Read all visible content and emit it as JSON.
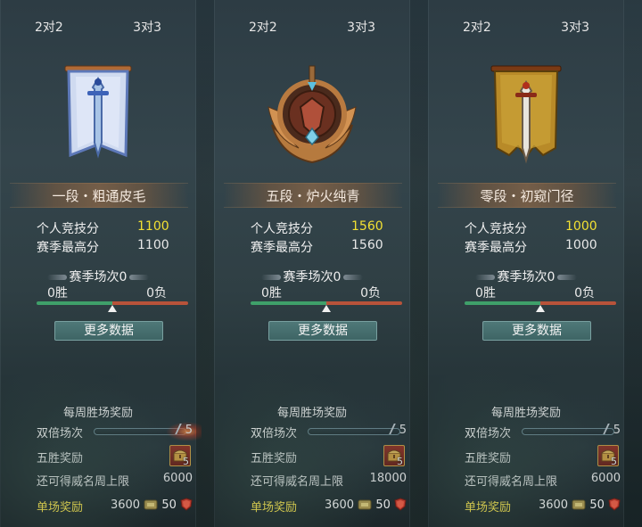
{
  "panels": [
    {
      "tabs": {
        "left": "2对2",
        "right": "3对3"
      },
      "rank_name": "一段・粗通皮毛",
      "emblem": "blue-banner-sword-icon",
      "stats": {
        "personal_label": "个人竞技分",
        "personal_value": "1100",
        "season_best_label": "赛季最高分",
        "season_best_value": "1100"
      },
      "season": {
        "title": "赛季场次0",
        "wins": "0胜",
        "losses": "0负",
        "win_ratio": 0.5
      },
      "more_button": "更多数据",
      "weekly": {
        "title": "每周胜场奖励",
        "double_label": "双倍场次",
        "double_count": "5",
        "double_progress": 0.0,
        "five_win_label": "五胜奖励",
        "chest_count": "5",
        "prestige_label": "还可得威名周上限",
        "prestige_value": "6000",
        "single_label": "单场奖励",
        "single_coins": "3600",
        "single_shield": "50"
      }
    },
    {
      "tabs": {
        "left": "2对2",
        "right": "3对3"
      },
      "rank_name": "五段・炉火纯青",
      "emblem": "bronze-winged-crest-icon",
      "stats": {
        "personal_label": "个人竞技分",
        "personal_value": "1560",
        "season_best_label": "赛季最高分",
        "season_best_value": "1560"
      },
      "season": {
        "title": "赛季场次0",
        "wins": "0胜",
        "losses": "0负",
        "win_ratio": 0.5
      },
      "more_button": "更多数据",
      "weekly": {
        "title": "每周胜场奖励",
        "double_label": "双倍场次",
        "double_count": "5",
        "double_progress": 0.0,
        "five_win_label": "五胜奖励",
        "chest_count": "5",
        "prestige_label": "还可得威名周上限",
        "prestige_value": "18000",
        "single_label": "单场奖励",
        "single_coins": "3600",
        "single_shield": "50"
      }
    },
    {
      "tabs": {
        "left": "2对2",
        "right": "3对3"
      },
      "rank_name": "零段・初窥门径",
      "emblem": "gold-banner-sword-icon",
      "stats": {
        "personal_label": "个人竞技分",
        "personal_value": "1000",
        "season_best_label": "赛季最高分",
        "season_best_value": "1000"
      },
      "season": {
        "title": "赛季场次0",
        "wins": "0胜",
        "losses": "0负",
        "win_ratio": 0.5
      },
      "more_button": "更多数据",
      "weekly": {
        "title": "每周胜场奖励",
        "double_label": "双倍场次",
        "double_count": "5",
        "double_progress": 0.0,
        "five_win_label": "五胜奖励",
        "chest_count": "5",
        "prestige_label": "还可得威名周上限",
        "prestige_value": "6000",
        "single_label": "单场奖励",
        "single_coins": "3600",
        "single_shield": "50"
      }
    }
  ],
  "colors": {
    "highlight_score": "#f2e033",
    "single_reward_label": "#f5e04a",
    "win_bar": "#3fa06a",
    "loss_bar": "#b8533a"
  }
}
